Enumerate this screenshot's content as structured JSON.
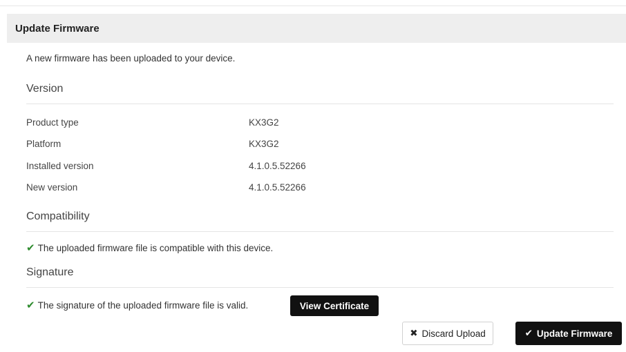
{
  "panel": {
    "title": "Update Firmware",
    "intro": "A new firmware has been uploaded to your device."
  },
  "version": {
    "title": "Version",
    "rows": [
      {
        "label": "Product type",
        "value": "KX3G2"
      },
      {
        "label": "Platform",
        "value": "KX3G2"
      },
      {
        "label": "Installed version",
        "value": "4.1.0.5.52266"
      },
      {
        "label": "New version",
        "value": "4.1.0.5.52266"
      }
    ]
  },
  "compatibility": {
    "title": "Compatibility",
    "message": "The uploaded firmware file is compatible with this device.",
    "icon": "check-icon",
    "color": "#2e8b2e"
  },
  "signature": {
    "title": "Signature",
    "message": "The signature of the uploaded firmware file is valid.",
    "icon": "check-icon",
    "view_certificate_label": "View Certificate"
  },
  "actions": {
    "discard_label": "Discard Upload",
    "discard_icon": "x-icon",
    "update_label": "Update Firmware",
    "update_icon": "check-icon"
  }
}
